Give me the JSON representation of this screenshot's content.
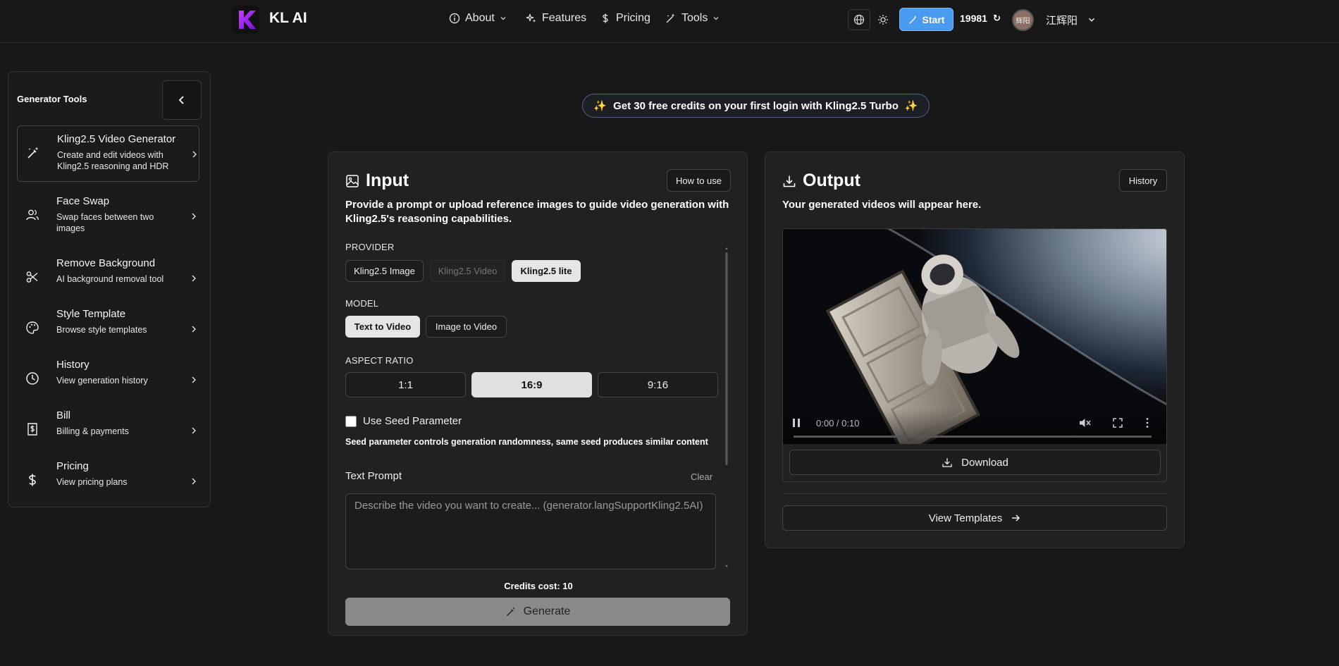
{
  "header": {
    "brand": "KL AI",
    "logo_letter": "K",
    "nav": [
      {
        "label": "About",
        "icon": "info-icon",
        "dropdown": true
      },
      {
        "label": "Features",
        "icon": "sparkles-icon",
        "dropdown": false
      },
      {
        "label": "Pricing",
        "icon": "dollar-icon",
        "dropdown": false
      },
      {
        "label": "Tools",
        "icon": "wand-icon",
        "dropdown": true
      }
    ],
    "start_label": "Start",
    "credits": "19981",
    "refresh_icon": "↻",
    "avatar_text": "辉阳",
    "username": "江辉阳"
  },
  "sidebar": {
    "title": "Generator Tools",
    "items": [
      {
        "title": "Kling2.5 Video Generator",
        "desc": "Create and edit videos with Kling2.5 reasoning and HDR",
        "icon": "magic-wand-icon"
      },
      {
        "title": "Face Swap",
        "desc": "Swap faces between two images",
        "icon": "users-icon"
      },
      {
        "title": "Remove Background",
        "desc": "AI background removal tool",
        "icon": "scissors-icon"
      },
      {
        "title": "Style Template",
        "desc": "Browse style templates",
        "icon": "palette-icon"
      },
      {
        "title": "History",
        "desc": "View generation history",
        "icon": "clock-icon"
      },
      {
        "title": "Bill",
        "desc": "Billing & payments",
        "icon": "receipt-icon"
      },
      {
        "title": "Pricing",
        "desc": "View pricing plans",
        "icon": "dollar-icon"
      }
    ]
  },
  "banner": {
    "emoji": "✨",
    "text": "Get 30 free credits on your first login with Kling2.5 Turbo"
  },
  "input": {
    "title": "Input",
    "how_to_use": "How to use",
    "description": "Provide a prompt or upload reference images to guide video generation with Kling2.5's reasoning capabilities.",
    "provider_label": "PROVIDER",
    "providers": [
      "Kling2.5 Image",
      "Kling2.5 Video",
      "Kling2.5 lite"
    ],
    "model_label": "MODEL",
    "models": [
      "Text to Video",
      "Image to Video"
    ],
    "aspect_label": "ASPECT RATIO",
    "aspects": [
      "1:1",
      "16:9",
      "9:16"
    ],
    "seed_label": "Use Seed Parameter",
    "seed_desc": "Seed parameter controls generation randomness, same seed produces similar content",
    "prompt_label": "Text Prompt",
    "clear_label": "Clear",
    "prompt_placeholder": "Describe the video you want to create... (generator.langSupportKling2.5AI)",
    "credits_cost": "Credits cost: 10",
    "generate_label": "Generate"
  },
  "output": {
    "title": "Output",
    "history_label": "History",
    "description": "Your generated videos will appear here.",
    "video_time": "0:00 / 0:10",
    "video_progress": 0.0,
    "download_label": "Download",
    "templates_label": "View Templates"
  },
  "colors": {
    "background": "#181818",
    "panel": "#212121",
    "accent": "#4a9af0",
    "logo_purple": "#a020f0"
  }
}
